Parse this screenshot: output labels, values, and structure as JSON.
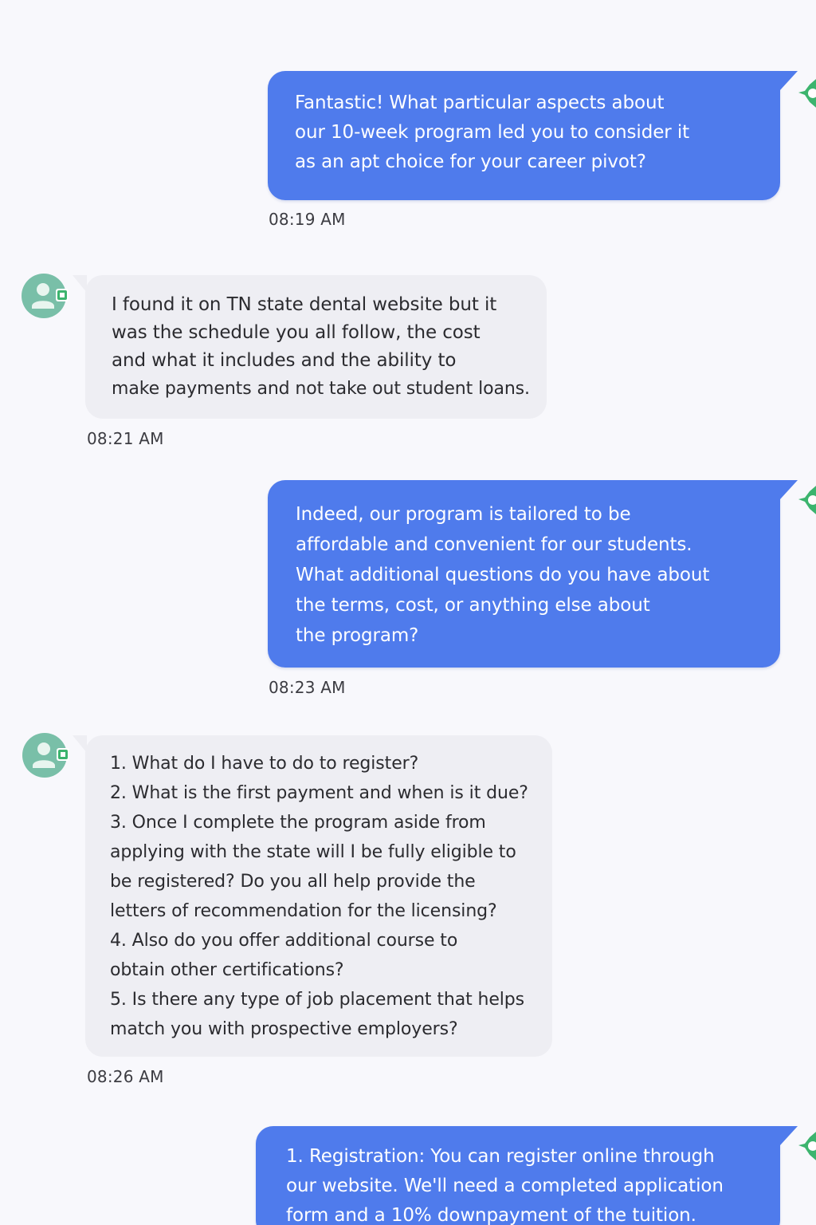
{
  "conversation": {
    "messages": [
      {
        "sender": "agent",
        "lines": [
          "Fantastic! What particular aspects about",
          "our 10-week program led you to consider it",
          "as an apt choice for your career pivot?"
        ],
        "time": "08:19 AM"
      },
      {
        "sender": "user",
        "lines": [
          "I found it on TN state dental website but it",
          "was the schedule you all follow, the cost",
          "and what it includes and the ability to",
          "make payments and not take out student loans."
        ],
        "time": "08:21 AM"
      },
      {
        "sender": "agent",
        "lines": [
          "Indeed, our program is tailored to be",
          "affordable and convenient for our students.",
          "What additional questions do you have about",
          "the terms, cost, or anything else about",
          "the program?"
        ],
        "time": "08:23 AM"
      },
      {
        "sender": "user",
        "lines": [
          "1. What do I have to do to register?",
          "2. What is the first payment and when is it due?",
          "3. Once I complete the program aside from",
          "applying with the state will I be fully eligible to",
          "be registered? Do you all help provide the",
          "letters of recommendation for the licensing?",
          "4. Also do you offer additional course to",
          "obtain other certifications?",
          "5. Is there any type of job placement that helps",
          "match you with prospective employers?"
        ],
        "time": "08:26 AM"
      },
      {
        "sender": "agent",
        "lines": [
          "1. Registration: You can register online through",
          "our website. We'll need a completed application",
          "form and a 10% downpayment of the tuition."
        ]
      }
    ]
  },
  "icons": {
    "user_avatar": "user-avatar-icon",
    "agent_avatar": "agent-avatar-icon"
  },
  "colors": {
    "outgoing_bubble": "#4f7bec",
    "incoming_bubble": "#eeeef3",
    "avatar_teal": "#79bfa8",
    "agent_green": "#3cb46e",
    "background": "#f8f8fc"
  }
}
